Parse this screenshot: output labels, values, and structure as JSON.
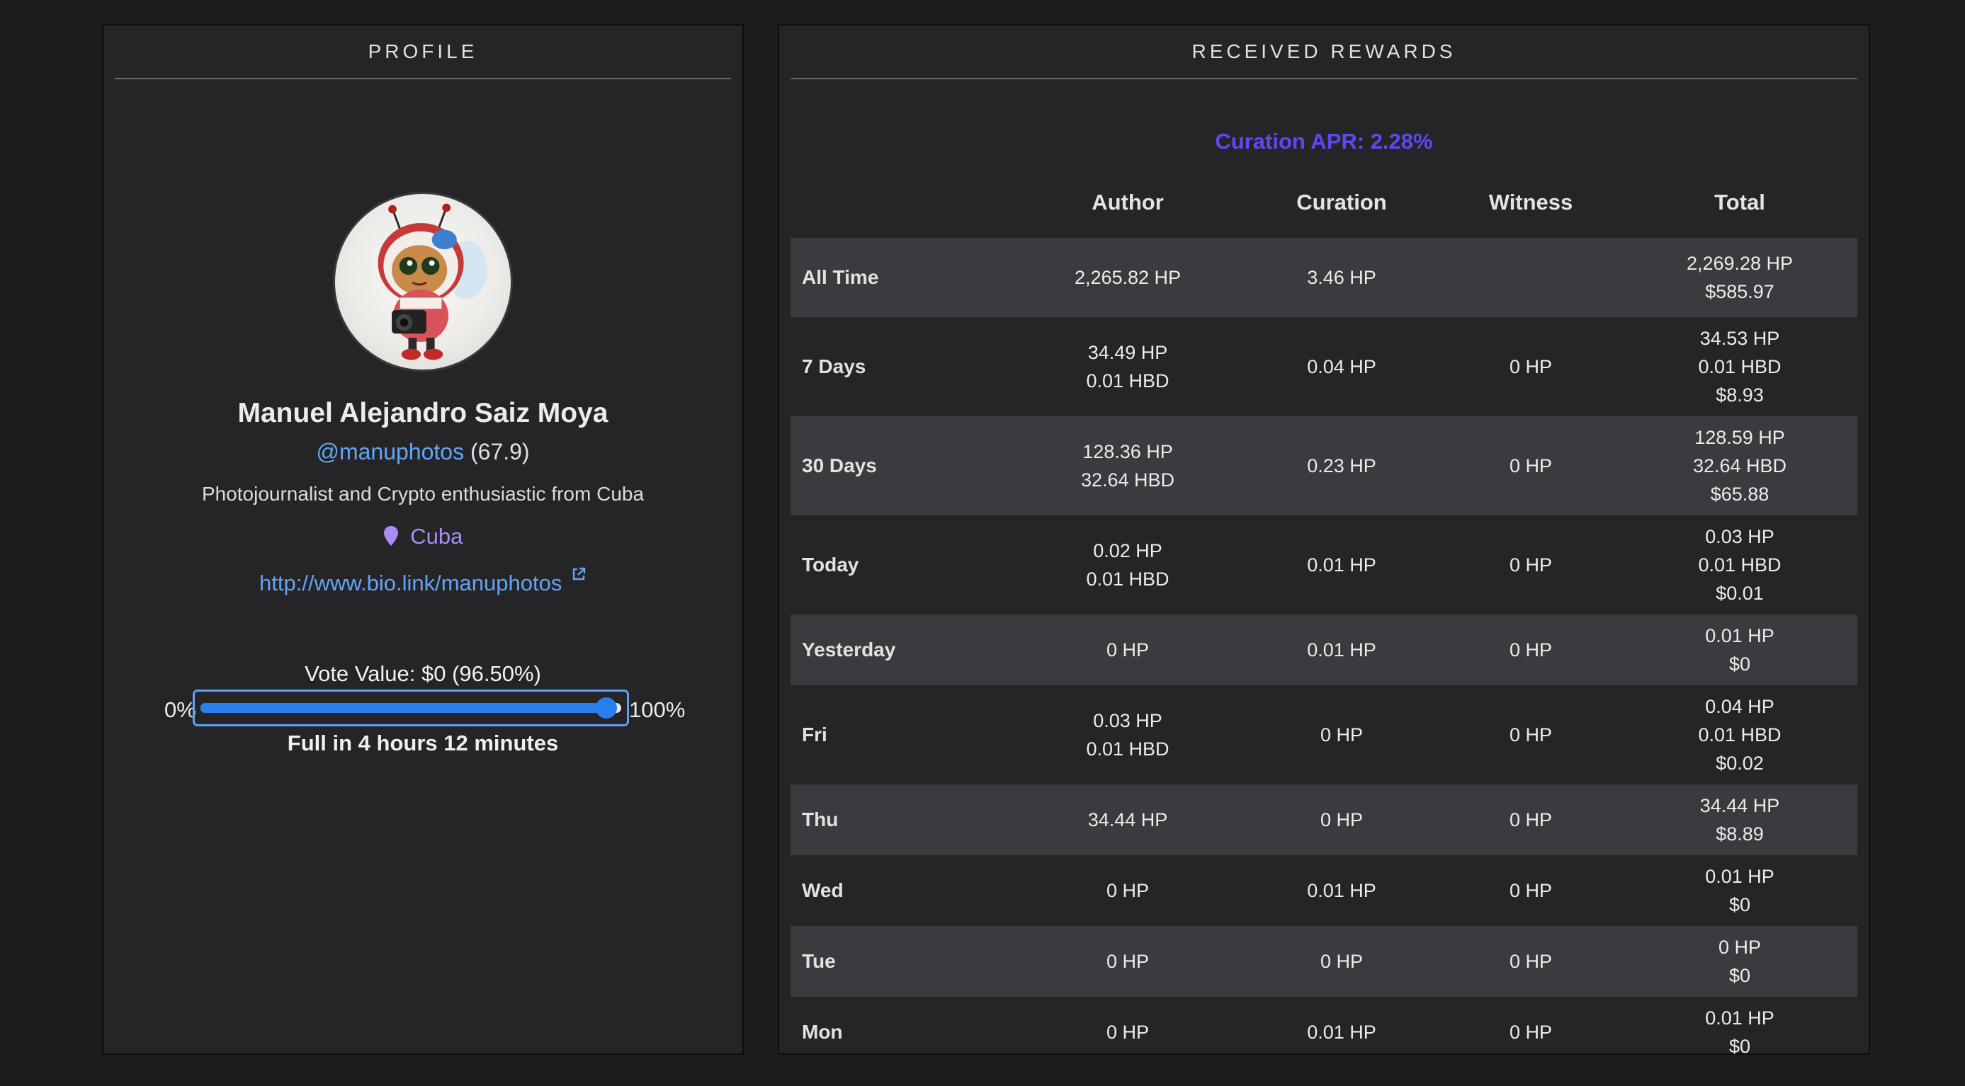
{
  "profile": {
    "header": "PROFILE",
    "name": "Manuel Alejandro Saiz Moya",
    "handle": "@manuphotos",
    "reputation": "(67.9)",
    "bio": "Photojournalist and Crypto enthusiastic from Cuba",
    "location": "Cuba",
    "website": "http://www.bio.link/manuphotos",
    "vote_value": "Vote Value: $0 (96.50%)",
    "slider_min": "0%",
    "slider_max": "100%",
    "voting_power_fraction": 0.965,
    "full_in": "Full in 4 hours 12 minutes",
    "icons": {
      "location": "map-pin-icon",
      "website": "external-link-icon"
    }
  },
  "rewards": {
    "header": "RECEIVED REWARDS",
    "apr": "Curation APR: 2.28%",
    "columns": [
      "Author",
      "Curation",
      "Witness",
      "Total"
    ],
    "rows": [
      {
        "label": "All Time",
        "author": [
          "2,265.82 HP"
        ],
        "curation": [
          "3.46 HP"
        ],
        "witness": [],
        "total": [
          "2,269.28 HP",
          "$585.97"
        ]
      },
      {
        "label": "7 Days",
        "author": [
          "34.49 HP",
          "0.01 HBD"
        ],
        "curation": [
          "0.04 HP"
        ],
        "witness": [
          "0 HP"
        ],
        "total": [
          "34.53 HP",
          "0.01 HBD",
          "$8.93"
        ]
      },
      {
        "label": "30 Days",
        "author": [
          "128.36 HP",
          "32.64 HBD"
        ],
        "curation": [
          "0.23 HP"
        ],
        "witness": [
          "0 HP"
        ],
        "total": [
          "128.59 HP",
          "32.64 HBD",
          "$65.88"
        ]
      },
      {
        "label": "Today",
        "author": [
          "0.02 HP",
          "0.01 HBD"
        ],
        "curation": [
          "0.01 HP"
        ],
        "witness": [
          "0 HP"
        ],
        "total": [
          "0.03 HP",
          "0.01 HBD",
          "$0.01"
        ]
      },
      {
        "label": "Yesterday",
        "author": [
          "0 HP"
        ],
        "curation": [
          "0.01 HP"
        ],
        "witness": [
          "0 HP"
        ],
        "total": [
          "0.01 HP",
          "$0"
        ]
      },
      {
        "label": "Fri",
        "author": [
          "0.03 HP",
          "0.01 HBD"
        ],
        "curation": [
          "0 HP"
        ],
        "witness": [
          "0 HP"
        ],
        "total": [
          "0.04 HP",
          "0.01 HBD",
          "$0.02"
        ]
      },
      {
        "label": "Thu",
        "author": [
          "34.44 HP"
        ],
        "curation": [
          "0 HP"
        ],
        "witness": [
          "0 HP"
        ],
        "total": [
          "34.44 HP",
          "$8.89"
        ]
      },
      {
        "label": "Wed",
        "author": [
          "0 HP"
        ],
        "curation": [
          "0.01 HP"
        ],
        "witness": [
          "0 HP"
        ],
        "total": [
          "0.01 HP",
          "$0"
        ]
      },
      {
        "label": "Tue",
        "author": [
          "0 HP"
        ],
        "curation": [
          "0 HP"
        ],
        "witness": [
          "0 HP"
        ],
        "total": [
          "0 HP",
          "$0"
        ]
      },
      {
        "label": "Mon",
        "author": [
          "0 HP"
        ],
        "curation": [
          "0.01 HP"
        ],
        "witness": [
          "0 HP"
        ],
        "total": [
          "0.01 HP",
          "$0"
        ]
      }
    ]
  },
  "colors": {
    "background": "#1d1d20",
    "panel": "#252528",
    "row_shaded": "#3a3a3f",
    "link": "#63a4f5",
    "location": "#a98df5",
    "apr": "#5a4af4",
    "slider": "#2a7ff0"
  }
}
